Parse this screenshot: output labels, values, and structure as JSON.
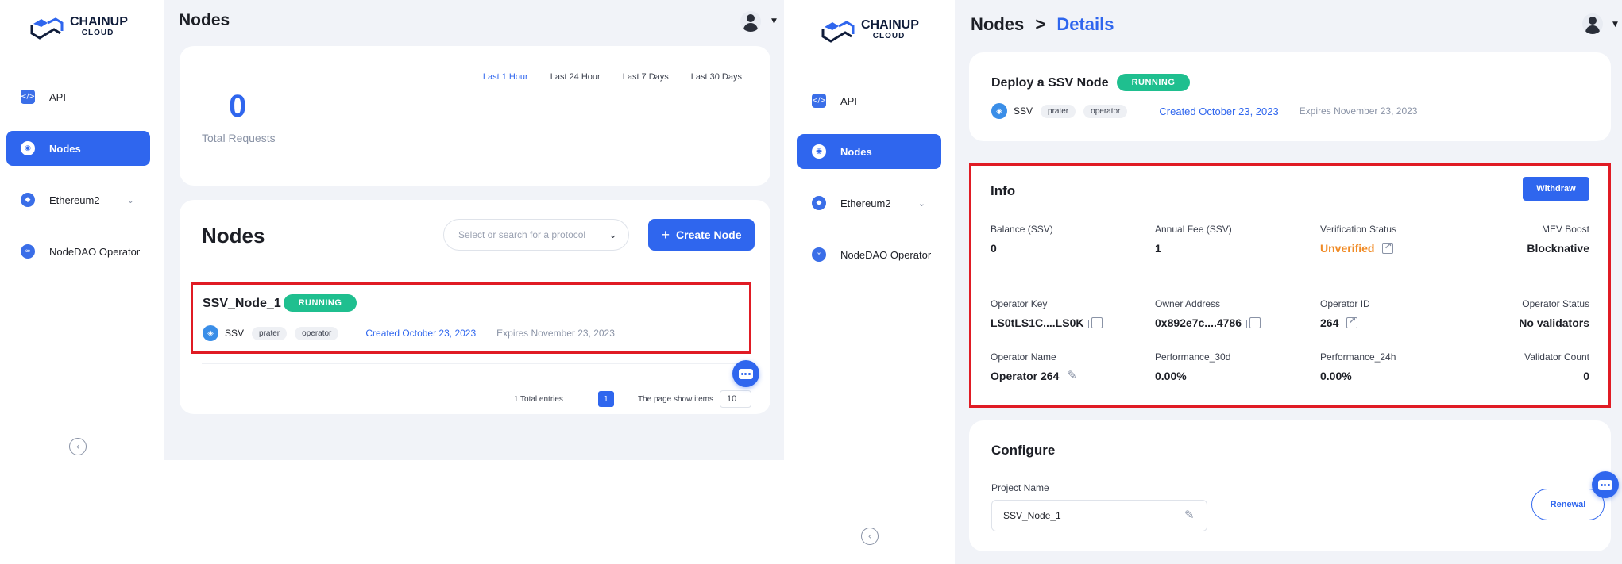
{
  "left": {
    "logo": {
      "brand": "CHAINUP",
      "sub": "CLOUD"
    },
    "sidebar": {
      "items": [
        {
          "label": "API",
          "icon": "code-icon"
        },
        {
          "label": "Nodes",
          "icon": "node-icon"
        },
        {
          "label": "Ethereum2",
          "icon": "ethereum-icon"
        },
        {
          "label": "NodeDAO Operator",
          "icon": "link-icon"
        }
      ],
      "collapse_glyph": "‹"
    },
    "header": {
      "title": "Nodes"
    },
    "stats": {
      "ranges": [
        "Last 1 Hour",
        "Last 24 Hour",
        "Last 7 Days",
        "Last 30 Days"
      ],
      "active_range": "Last 1 Hour",
      "total_value": "0",
      "total_label": "Total Requests"
    },
    "nodes": {
      "title": "Nodes",
      "search_placeholder": "Select or search for a protocol",
      "create_label": "Create Node",
      "row": {
        "name": "SSV_Node_1",
        "status": "RUNNING",
        "protocol": "SSV",
        "tags": [
          "prater",
          "operator"
        ],
        "created": "Created October 23, 2023",
        "expires": "Expires November 23, 2023"
      },
      "pager": {
        "total": "1 Total entries",
        "page": "1",
        "page_size_label": "The page show items",
        "page_size": "10"
      }
    }
  },
  "right": {
    "logo": {
      "brand": "CHAINUP",
      "sub": "CLOUD"
    },
    "sidebar": {
      "items": [
        {
          "label": "API",
          "icon": "code-icon"
        },
        {
          "label": "Nodes",
          "icon": "node-icon"
        },
        {
          "label": "Ethereum2",
          "icon": "ethereum-icon"
        },
        {
          "label": "NodeDAO Operator",
          "icon": "link-icon"
        }
      ]
    },
    "breadcrumb": {
      "parent": "Nodes",
      "sep": ">",
      "current": "Details"
    },
    "deploy": {
      "title": "Deploy a SSV Node",
      "status": "RUNNING",
      "protocol": "SSV",
      "tags": [
        "prater",
        "operator"
      ],
      "created": "Created October 23, 2023",
      "expires": "Expires November 23, 2023"
    },
    "info": {
      "title": "Info",
      "withdraw_label": "Withdraw",
      "fields": {
        "balance": {
          "label": "Balance (SSV)",
          "value": "0"
        },
        "annual_fee": {
          "label": "Annual Fee (SSV)",
          "value": "1"
        },
        "verification": {
          "label": "Verification Status",
          "value": "Unverified"
        },
        "mev": {
          "label": "MEV Boost",
          "value": "Blocknative"
        },
        "operator_key": {
          "label": "Operator Key",
          "value": "LS0tLS1C....LS0K"
        },
        "owner_address": {
          "label": "Owner Address",
          "value": "0x892e7c....4786"
        },
        "operator_id": {
          "label": "Operator ID",
          "value": "264"
        },
        "operator_status": {
          "label": "Operator Status",
          "value": "No validators"
        },
        "operator_name": {
          "label": "Operator Name",
          "value": "Operator 264"
        },
        "perf30": {
          "label": "Performance_30d",
          "value": "0.00%"
        },
        "perf24": {
          "label": "Performance_24h",
          "value": "0.00%"
        },
        "validator_count": {
          "label": "Validator Count",
          "value": "0"
        }
      }
    },
    "configure": {
      "title": "Configure",
      "project_label": "Project Name",
      "project_value": "SSV_Node_1",
      "renewal_label": "Renewal"
    }
  },
  "colors": {
    "accent": "#2f66ee",
    "running": "#1fbf8f",
    "highlight": "#e01b24",
    "warning": "#f08a24"
  }
}
